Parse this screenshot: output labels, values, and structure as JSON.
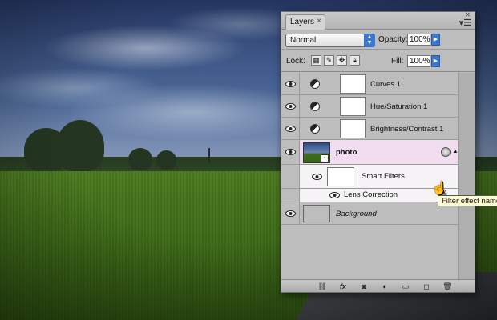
{
  "panel": {
    "tab_label": "Layers",
    "tab_close": "×",
    "menu_icon": "panel-menu-icon",
    "blend_mode": "Normal",
    "opacity_label": "Opacity:",
    "opacity_value": "100%",
    "lock_label": "Lock:",
    "fill_label": "Fill:",
    "fill_value": "100%"
  },
  "layers": [
    {
      "name": "Curves 1",
      "type": "adjustment"
    },
    {
      "name": "Hue/Saturation 1",
      "type": "adjustment"
    },
    {
      "name": "Brightness/Contrast 1",
      "type": "adjustment"
    },
    {
      "name": "photo",
      "type": "smart-object"
    },
    {
      "name": "Smart Filters",
      "type": "smart-filters"
    },
    {
      "name": "Lens Correction",
      "type": "filter"
    },
    {
      "name": "Background",
      "type": "background"
    }
  ],
  "tooltip": "Filter effect name",
  "footer_icons": [
    "link-icon",
    "fx-icon",
    "mask-icon",
    "adjustment-icon",
    "folder-icon",
    "new-layer-icon",
    "trash-icon"
  ],
  "colors": {
    "accent": "#3a78d0",
    "selected_row": "#f2dcf0",
    "panel_bg": "#bdbdbd"
  }
}
